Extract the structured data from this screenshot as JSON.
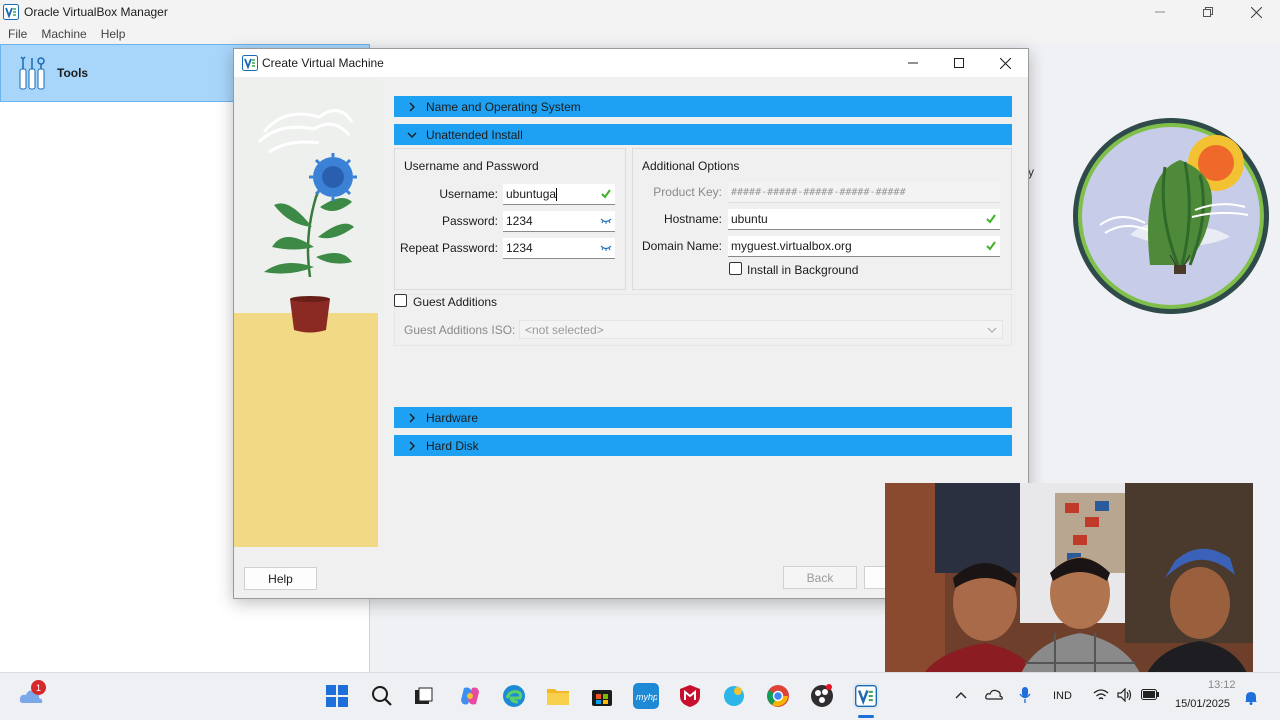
{
  "main_window": {
    "title": "Oracle VirtualBox Manager",
    "menu": [
      "File",
      "Machine",
      "Help"
    ],
    "tools_label": "Tools",
    "partial_text": "y"
  },
  "dialog": {
    "title": "Create Virtual Machine",
    "sections": {
      "name_os": "Name and Operating System",
      "unattended": "Unattended Install",
      "hardware": "Hardware",
      "hard_disk": "Hard Disk"
    },
    "username_password": {
      "group_title": "Username and Password",
      "username_label": "Username:",
      "username_value": "ubuntuga",
      "password_label": "Password:",
      "password_value": "1234",
      "repeat_label": "Repeat Password:",
      "repeat_value": "1234"
    },
    "additional_options": {
      "group_title": "Additional Options",
      "product_key_label": "Product Key:",
      "product_key_placeholder": "#####-#####-#####-#####-#####",
      "hostname_label": "Hostname:",
      "hostname_value": "ubuntu",
      "domain_label": "Domain Name:",
      "domain_value": "myguest.virtualbox.org",
      "install_bg_label": "Install in Background",
      "install_bg_checked": false
    },
    "guest_additions": {
      "label": "Guest Additions",
      "checked": false,
      "iso_label": "Guest Additions ISO:",
      "iso_value": "<not selected>"
    },
    "buttons": {
      "help": "Help",
      "back": "Back"
    }
  },
  "taskbar": {
    "weather_badge": "1",
    "lang": "IND",
    "time": "13:12",
    "date": "15/01/2025"
  },
  "colors": {
    "section_bar": "#1ea1f2",
    "tools_highlight": "#a8d6fb",
    "illustration_bg": "#f1d985"
  }
}
